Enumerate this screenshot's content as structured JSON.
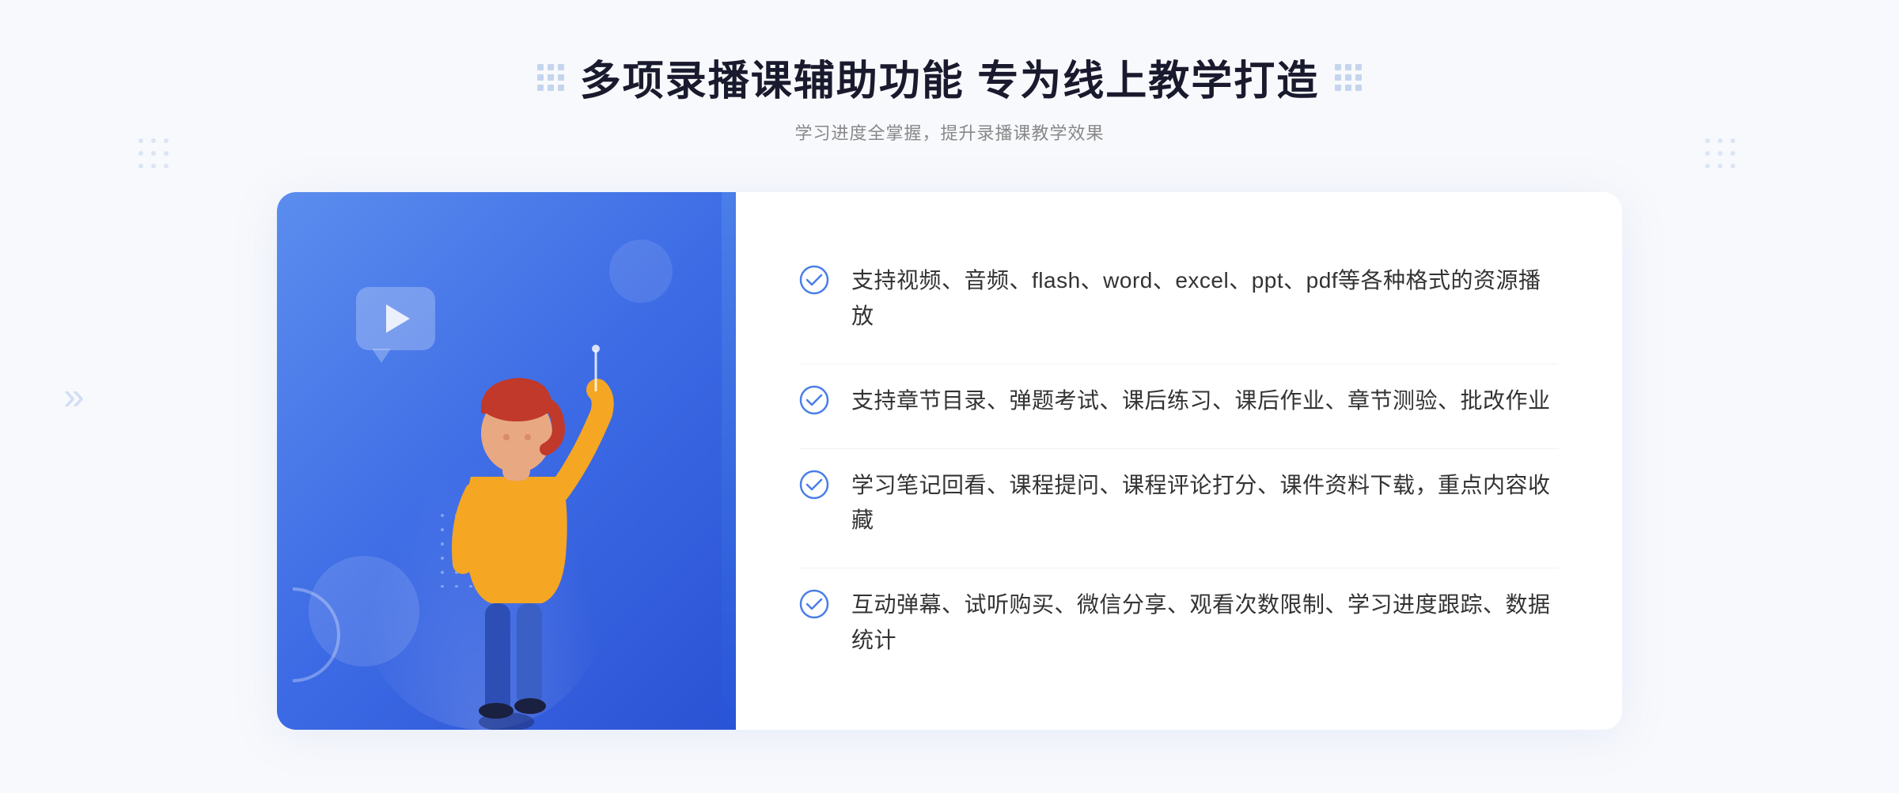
{
  "header": {
    "main_title": "多项录播课辅助功能 专为线上教学打造",
    "subtitle": "学习进度全掌握，提升录播课教学效果"
  },
  "features": [
    {
      "id": 1,
      "text": "支持视频、音频、flash、word、excel、ppt、pdf等各种格式的资源播放"
    },
    {
      "id": 2,
      "text": "支持章节目录、弹题考试、课后练习、课后作业、章节测验、批改作业"
    },
    {
      "id": 3,
      "text": "学习笔记回看、课程提问、课程评论打分、课件资料下载，重点内容收藏"
    },
    {
      "id": 4,
      "text": "互动弹幕、试听购买、微信分享、观看次数限制、学习进度跟踪、数据统计"
    }
  ],
  "colors": {
    "accent_blue": "#4a7ee8",
    "title_dark": "#1a1a2e",
    "text_gray": "#888888",
    "feature_text": "#333333",
    "check_blue": "#4a7ee8",
    "border": "#f0f2f8"
  },
  "icons": {
    "check_circle": "✓",
    "chevron": "»",
    "play": "▶"
  }
}
